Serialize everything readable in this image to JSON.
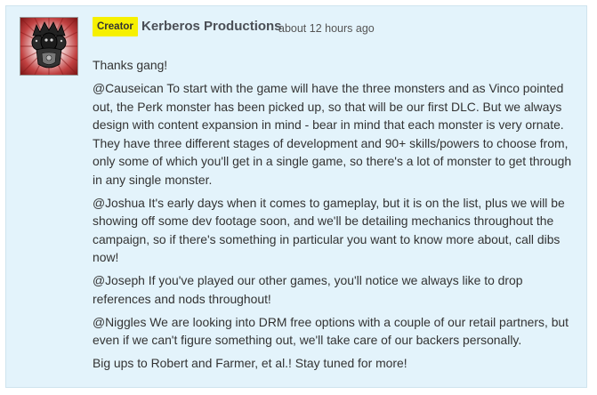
{
  "comment": {
    "badge": "Creator",
    "author": "Kerberos Productions",
    "timestamp": "about 12 hours ago",
    "paragraphs": [
      "Thanks gang!",
      "@Causeican To start with the game will have the three monsters and as Vinco pointed out, the Perk monster has been picked up, so that will be our first DLC. But we always design with content expansion in mind - bear in mind that each monster is very ornate. They have three different stages of development and 90+ skills/powers to choose from, only some of which you'll get in a single game, so there's a lot of monster to get through in any single monster.",
      "@Joshua It's early days when it comes to gameplay, but it is on the list, plus we will be showing off some dev footage soon, and we'll be detailing mechanics throughout the campaign, so if there's something in particular you want to know more about, call dibs now!",
      "@Joseph If you've played our other games, you'll notice we always like to drop references and nods throughout!",
      "@Niggles We are looking into DRM free options with a couple of our retail partners, but even if we can't figure something out, we'll take care of our backers personally.",
      "Big ups to Robert and Farmer, et al.! Stay tuned for more!"
    ]
  },
  "colors": {
    "background": "#e3f3fb",
    "badge": "#f6f000",
    "text": "#333333",
    "author": "#4b4f56"
  },
  "icons": {
    "avatar": "kerberos-emblem"
  }
}
